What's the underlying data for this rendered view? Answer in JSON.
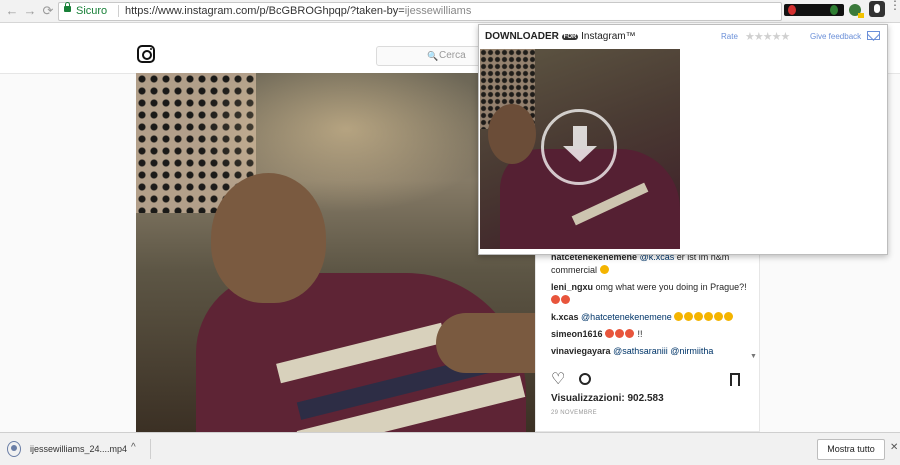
{
  "browser": {
    "secure_label": "Sicuro",
    "url_main": "https://www.instagram.com/p/BcGBROGhpqp/?taken-by=",
    "url_tail": "ijessewilliams",
    "back_glyph": "←",
    "forward_glyph": "→",
    "reload_glyph": "⟳",
    "star_glyph": "☆",
    "menu_glyph": "⋮"
  },
  "instagram": {
    "search_placeholder": "Cerca",
    "search_glyph": "🔍"
  },
  "downloader": {
    "title": "DOWNLOADER",
    "badge": "FOR",
    "title_suffix": "Instagram™",
    "rate_label": "Rate",
    "stars": "★★★★★",
    "feedback_label": "Give feedback"
  },
  "comments": [
    {
      "user": "hatcetenekenemene",
      "mention": "@k.xcas",
      "text": " er ist im h&m commercial",
      "emojis": [
        "yellow"
      ]
    },
    {
      "user": "leni_ngxu",
      "mention": "",
      "text": " omg what were you doing in Prague?!",
      "emojis": [
        "red",
        "red"
      ]
    },
    {
      "user": "k.xcas",
      "mention": "@hatcetenekenemene",
      "text": "",
      "emojis": [
        "yellow",
        "yellow",
        "yellow",
        "yellow",
        "yellow",
        "yellow"
      ]
    },
    {
      "user": "simeon1616",
      "mention": "",
      "text": "",
      "emojis": [
        "red",
        "red",
        "red"
      ],
      "after": " !!"
    },
    {
      "user": "vinaviegayara",
      "mention": "@sathsaraniii @nirmiitha",
      "text": "",
      "emojis": []
    }
  ],
  "post": {
    "heart_glyph": "♡",
    "views_label": "Visualizzazioni: 902.583",
    "date": "29 NOVEMBRE"
  },
  "downloads": {
    "file_name": "ijessewilliams_24....mp4",
    "chevron": "^",
    "show_all_label": "Mostra tutto",
    "close_glyph": "✕"
  }
}
